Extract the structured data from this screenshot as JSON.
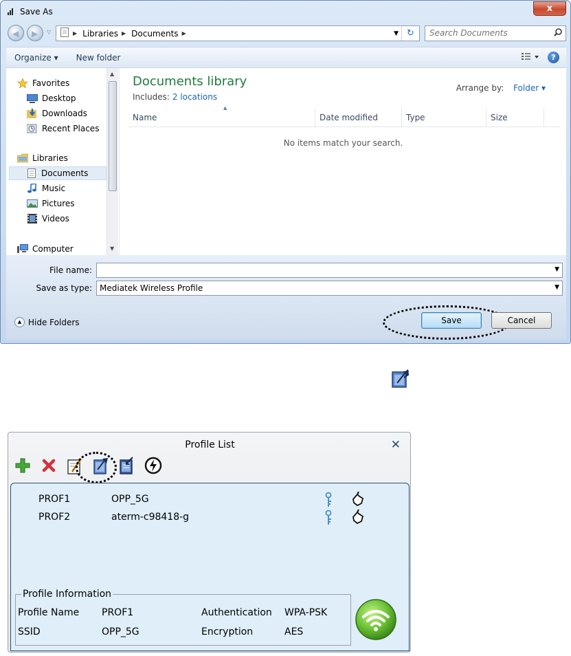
{
  "save_as": {
    "title": "Save As",
    "close": "x",
    "breadcrumbs": [
      "Libraries",
      "Documents"
    ],
    "search_placeholder": "Search Documents",
    "commands": {
      "organize": "Organize ▾",
      "new_folder": "New folder"
    },
    "nav": {
      "favorites": "Favorites",
      "desktop": "Desktop",
      "downloads": "Downloads",
      "recent": "Recent Places",
      "libraries": "Libraries",
      "documents": "Documents",
      "music": "Music",
      "pictures": "Pictures",
      "videos": "Videos",
      "computer": "Computer"
    },
    "library_title": "Documents library",
    "includes_label": "Includes:",
    "includes_link": "2 locations",
    "arrange_label": "Arrange by:",
    "arrange_value": "Folder ▾",
    "columns": [
      "Name",
      "Date modified",
      "Type",
      "Size"
    ],
    "empty_message": "No items match your search.",
    "file_name_label": "File name:",
    "file_name_value": "",
    "save_type_label": "Save as type:",
    "save_type_value": "Mediatek Wireless Profile",
    "hide_folders": "Hide Folders",
    "save_button": "Save",
    "cancel_button": "Cancel"
  },
  "profile_list": {
    "title": "Profile List",
    "close": "✕",
    "profiles": [
      {
        "name": "PROF1",
        "ssid": "OPP_5G"
      },
      {
        "name": "PROF2",
        "ssid": "aterm-c98418-g"
      }
    ],
    "info": {
      "legend": "Profile Information",
      "profile_name_label": "Profile Name",
      "profile_name": "PROF1",
      "ssid_label": "SSID",
      "ssid": "OPP_5G",
      "auth_label": "Authentication",
      "auth": "WPA-PSK",
      "enc_label": "Encryption",
      "enc": "AES"
    }
  },
  "colors": {
    "library_green": "#1e7b3c",
    "link_blue": "#1667b8",
    "list_bg": "#dfeef8"
  },
  "icons": [
    "signal-icon",
    "back-icon",
    "forward-icon",
    "folder-icon",
    "refresh-icon",
    "search-icon",
    "view-icon",
    "help-icon",
    "star-icon",
    "desktop-icon",
    "downloads-icon",
    "recent-places-icon",
    "libraries-icon",
    "documents-icon",
    "music-icon",
    "pictures-icon",
    "videos-icon",
    "computer-icon",
    "add-icon",
    "delete-icon",
    "edit-icon",
    "export-icon",
    "import-icon",
    "activate-icon",
    "key-icon",
    "hand-icon",
    "wifi-icon"
  ]
}
